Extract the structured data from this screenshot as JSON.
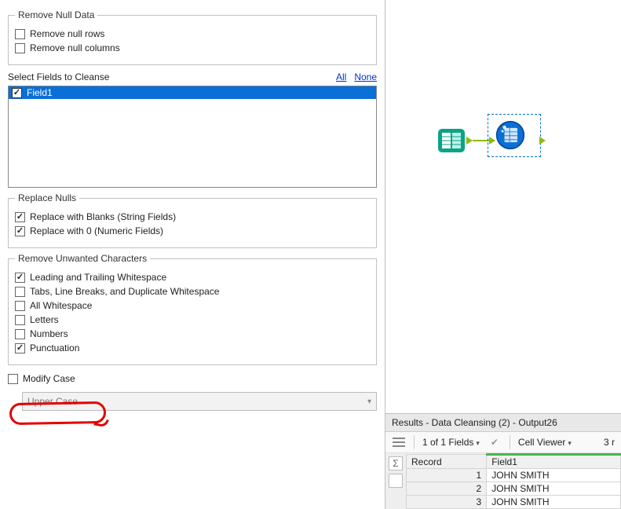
{
  "sections": {
    "remove_null": {
      "legend": "Remove Null Data",
      "opts": {
        "rows": {
          "label": "Remove null rows",
          "checked": false
        },
        "cols": {
          "label": "Remove null columns",
          "checked": false
        }
      }
    },
    "select_fields": {
      "label": "Select Fields to Cleanse",
      "all": "All",
      "none": "None",
      "fields": [
        {
          "name": "Field1",
          "checked": true,
          "selected": true
        }
      ]
    },
    "replace_nulls": {
      "legend": "Replace Nulls",
      "opts": {
        "blanks": {
          "label": "Replace with Blanks (String Fields)",
          "checked": true
        },
        "zeros": {
          "label": "Replace with 0 (Numeric Fields)",
          "checked": true
        }
      }
    },
    "remove_chars": {
      "legend": "Remove Unwanted Characters",
      "opts": {
        "trim": {
          "label": "Leading and Trailing Whitespace",
          "checked": true
        },
        "dup": {
          "label": "Tabs, Line Breaks, and Duplicate Whitespace",
          "checked": false
        },
        "allws": {
          "label": "All Whitespace",
          "checked": false
        },
        "letters": {
          "label": "Letters",
          "checked": false
        },
        "numbers": {
          "label": "Numbers",
          "checked": false
        },
        "punct": {
          "label": "Punctuation",
          "checked": true
        }
      }
    },
    "modify_case": {
      "label": "Modify Case",
      "checked": false,
      "select_value": "Upper Case"
    }
  },
  "canvas": {
    "input_node_name": "text-input-tool",
    "cleanse_node_name": "data-cleansing-tool"
  },
  "results": {
    "title": "Results - Data Cleansing (2) - Output26",
    "fields_summary": "1 of 1 Fields",
    "cell_viewer": "Cell Viewer",
    "record_count_fragment": "3 r",
    "columns": {
      "record": "Record",
      "field1": "Field1"
    },
    "rows": [
      {
        "i": "1",
        "v": "JOHN SMITH"
      },
      {
        "i": "2",
        "v": "JOHN SMITH"
      },
      {
        "i": "3",
        "v": "JOHN SMITH"
      }
    ]
  }
}
